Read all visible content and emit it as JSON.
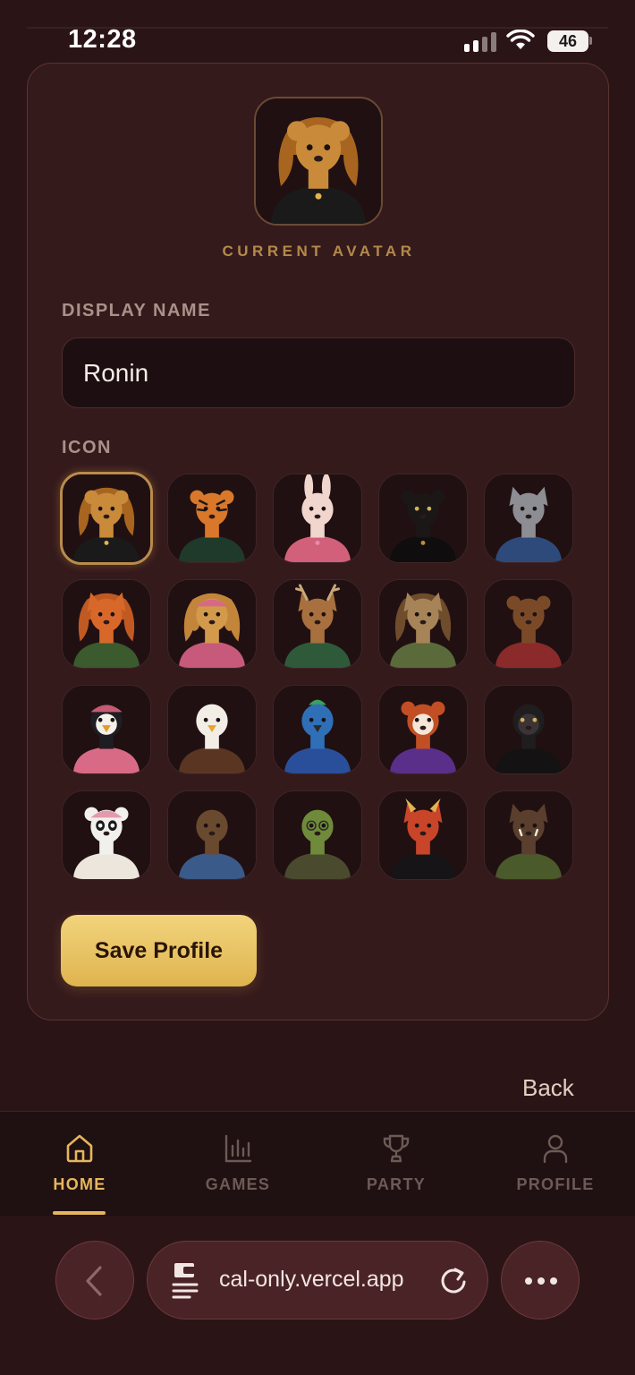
{
  "status_bar": {
    "time": "12:28",
    "battery": "46"
  },
  "profile_card": {
    "current_avatar_label": "CURRENT AVATAR",
    "display_name_label": "DISPLAY NAME",
    "display_name_value": "Ronin",
    "icon_label": "ICON",
    "selected_icon": "lioness",
    "icons": [
      "lioness",
      "tiger",
      "bunny",
      "black-panther",
      "wolf",
      "fox",
      "golden-retriever",
      "deer",
      "tabby-cat",
      "bear",
      "penguin",
      "eagle",
      "parrot",
      "red-panda",
      "gorilla",
      "panda",
      "otter",
      "turtle",
      "dragon",
      "boar"
    ],
    "save_label": "Save Profile"
  },
  "back_label": "Back",
  "bottom_nav": {
    "active": "HOME",
    "items": [
      {
        "label": "HOME",
        "icon": "home-icon"
      },
      {
        "label": "GAMES",
        "icon": "bar-chart-icon"
      },
      {
        "label": "PARTY",
        "icon": "trophy-icon"
      },
      {
        "label": "PROFILE",
        "icon": "person-icon"
      }
    ]
  },
  "browser": {
    "url": "cal-only.vercel.app",
    "back_icon": "chevron-left-icon",
    "tabs_icon": "page-icon",
    "reload_icon": "reload-icon",
    "more_icon": "more-icon"
  },
  "colors": {
    "background": "#2b1416",
    "card": "#351a1c",
    "accent": "#e6b65c",
    "button": "#e8c263"
  }
}
